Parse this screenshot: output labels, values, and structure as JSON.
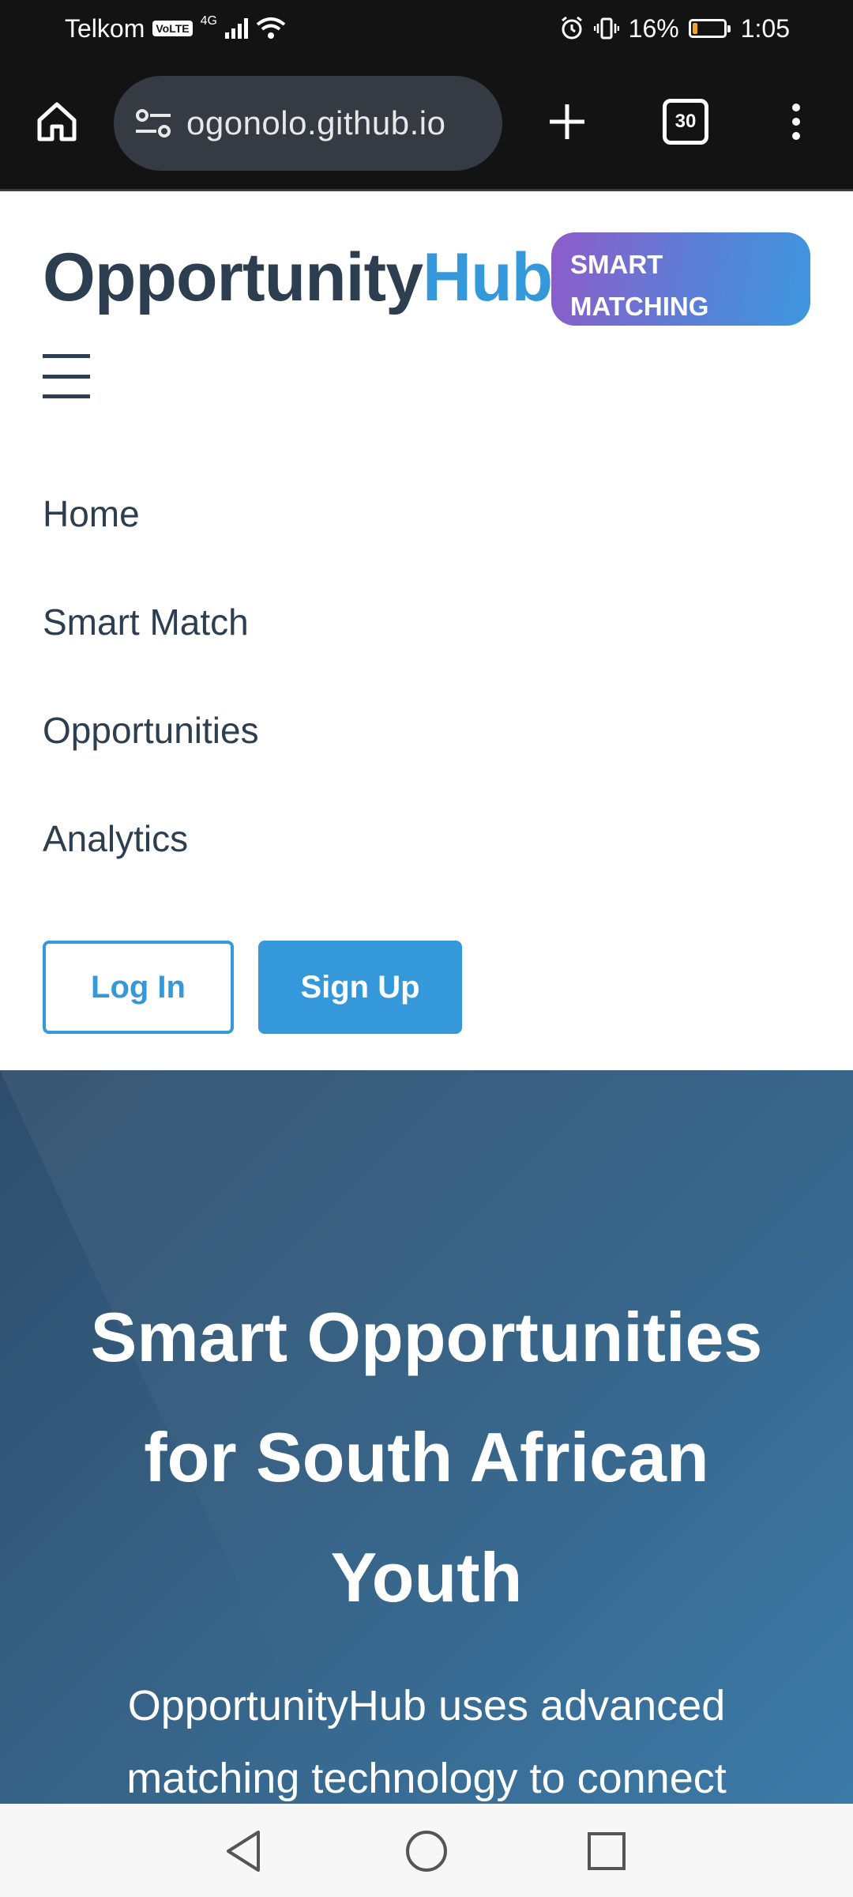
{
  "status_bar": {
    "carrier": "Telkom",
    "volte": "VoLTE",
    "network": "4G",
    "battery": "16%",
    "battery_level": 0.16,
    "time": "1:05"
  },
  "browser": {
    "url": "ogonolo.github.io",
    "tab_count": "30",
    "icons": [
      "home-icon",
      "site-settings-icon",
      "new-tab-icon",
      "tab-switcher-icon",
      "more-menu-icon"
    ]
  },
  "header": {
    "logo_main": "Opportunity",
    "logo_accent": "Hub",
    "badge_line1": "SMART",
    "badge_line2": "MATCHING"
  },
  "nav": {
    "items": [
      {
        "label": "Home"
      },
      {
        "label": "Smart Match"
      },
      {
        "label": "Opportunities"
      },
      {
        "label": "Analytics"
      }
    ],
    "login_label": "Log In",
    "signup_label": "Sign Up"
  },
  "hero": {
    "title_line1": "Smart Opportunities",
    "title_line2": "for South African",
    "title_line3": "Youth",
    "subtitle_line1": "OpportunityHub uses advanced",
    "subtitle_line2": "matching technology to connect"
  },
  "colors": {
    "brand_dark": "#2c3e50",
    "brand_accent": "#3498db",
    "badge_gradient_start": "#8e5cc9",
    "badge_gradient_end": "#3d96de",
    "hero_bg": "#366184"
  }
}
